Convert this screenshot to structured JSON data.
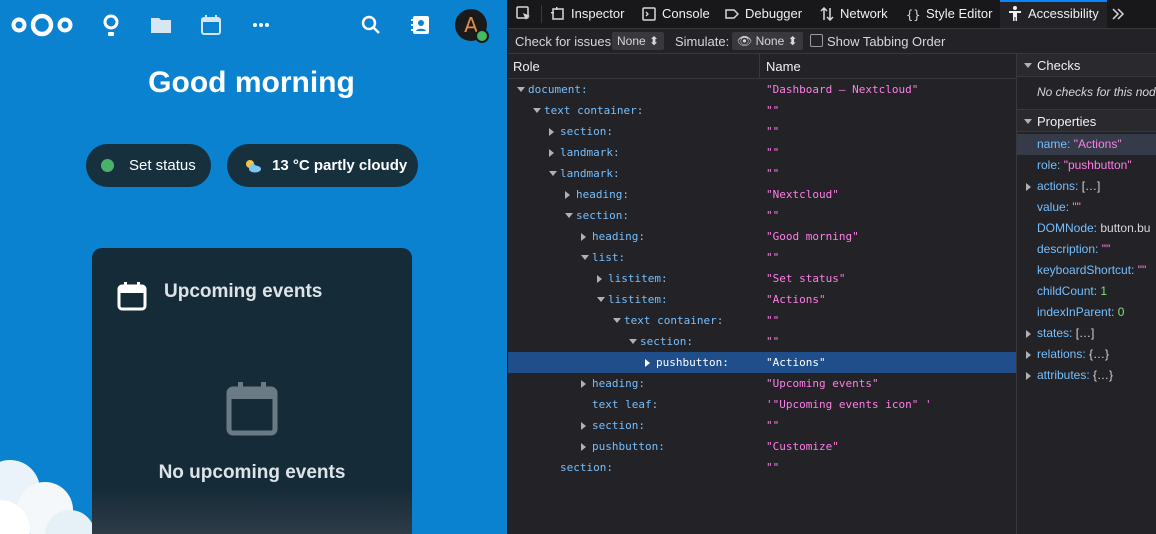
{
  "nextcloud": {
    "greeting": "Good morning",
    "set_status_label": "Set status",
    "weather_label": "13 °C partly cloudy",
    "avatar_letter": "A",
    "card": {
      "title": "Upcoming events",
      "empty_text": "No upcoming events"
    },
    "header_icons": [
      "nextcloud-logo",
      "dashboard-icon",
      "files-icon",
      "calendar-icon",
      "more-apps-icon",
      "search-icon",
      "contacts-icon"
    ],
    "colors": {
      "background": "#0a82d0",
      "pill": "#16303d",
      "status_online": "#49b36b"
    }
  },
  "devtools": {
    "tabs": [
      {
        "label": "Inspector",
        "icon": "inspector-icon"
      },
      {
        "label": "Console",
        "icon": "console-icon"
      },
      {
        "label": "Debugger",
        "icon": "debugger-icon"
      },
      {
        "label": "Network",
        "icon": "network-icon"
      },
      {
        "label": "Style Editor",
        "icon": "style-editor-icon"
      },
      {
        "label": "Accessibility",
        "icon": "accessibility-icon",
        "active": true
      }
    ],
    "toolbar": {
      "check_label": "Check for issues:",
      "check_value": "None",
      "simulate_label": "Simulate:",
      "simulate_value": "None",
      "tabbing_label": "Show Tabbing Order"
    },
    "columns": {
      "role": "Role",
      "name": "Name"
    },
    "rows": [
      {
        "role": "document:",
        "name": "\"Dashboard – Nextcloud\"",
        "depth": 0,
        "twisty": "open"
      },
      {
        "role": "text container:",
        "name": "\"\"",
        "depth": 1,
        "twisty": "open"
      },
      {
        "role": "section:",
        "name": "\"\"",
        "depth": 2,
        "twisty": "closed"
      },
      {
        "role": "landmark:",
        "name": "\"\"",
        "depth": 2,
        "twisty": "closed"
      },
      {
        "role": "landmark:",
        "name": "\"\"",
        "depth": 2,
        "twisty": "open"
      },
      {
        "role": "heading:",
        "name": "\"Nextcloud\"",
        "depth": 3,
        "twisty": "closed"
      },
      {
        "role": "section:",
        "name": "\"\"",
        "depth": 3,
        "twisty": "open"
      },
      {
        "role": "heading:",
        "name": "\"Good morning\"",
        "depth": 4,
        "twisty": "closed"
      },
      {
        "role": "list:",
        "name": "\"\"",
        "depth": 4,
        "twisty": "open"
      },
      {
        "role": "listitem:",
        "name": "\"Set status\"",
        "depth": 5,
        "twisty": "closed"
      },
      {
        "role": "listitem:",
        "name": "\"Actions\"",
        "depth": 5,
        "twisty": "open"
      },
      {
        "role": "text container:",
        "name": "\"\"",
        "depth": 6,
        "twisty": "open"
      },
      {
        "role": "section:",
        "name": "\"\"",
        "depth": 7,
        "twisty": "open"
      },
      {
        "role": "pushbutton:",
        "name": "\"Actions\"",
        "depth": 8,
        "twisty": "closed",
        "selected": true
      },
      {
        "role": "heading:",
        "name": "\"Upcoming events\"",
        "depth": 4,
        "twisty": "closed"
      },
      {
        "role": "text leaf:",
        "name": "'\"Upcoming events icon\" '",
        "depth": 4,
        "twisty": "none"
      },
      {
        "role": "section:",
        "name": "\"\"",
        "depth": 4,
        "twisty": "closed"
      },
      {
        "role": "pushbutton:",
        "name": "\"Customize\"",
        "depth": 4,
        "twisty": "closed"
      },
      {
        "role": "section:",
        "name": "\"\"",
        "depth": 2,
        "twisty": "none"
      }
    ],
    "sidebar": {
      "checks_header": "Checks",
      "checks_note": "No checks for this node",
      "properties_header": "Properties",
      "properties": [
        {
          "key": "name:",
          "value": "\"Actions\"",
          "kind": "str",
          "highlight": true
        },
        {
          "key": "role:",
          "value": "\"pushbutton\"",
          "kind": "str"
        },
        {
          "key": "actions:",
          "value": "[…]",
          "kind": "plain",
          "expandable": true
        },
        {
          "key": "value:",
          "value": "\"\"",
          "kind": "str"
        },
        {
          "key": "DOMNode:",
          "value": "button.bu",
          "kind": "plain"
        },
        {
          "key": "description:",
          "value": "\"\"",
          "kind": "str"
        },
        {
          "key": "keyboardShortcut:",
          "value": "\"\"",
          "kind": "str"
        },
        {
          "key": "childCount:",
          "value": "1",
          "kind": "num"
        },
        {
          "key": "indexInParent:",
          "value": "0",
          "kind": "num"
        },
        {
          "key": "states:",
          "value": "[…]",
          "kind": "plain",
          "expandable": true
        },
        {
          "key": "relations:",
          "value": "{…}",
          "kind": "plain",
          "expandable": true
        },
        {
          "key": "attributes:",
          "value": "{…}",
          "kind": "plain",
          "expandable": true
        }
      ]
    },
    "colors": {
      "accent": "#0a84ff",
      "selected_row": "#204e8a",
      "role_text": "#75bfff",
      "string_text": "#ff7de9",
      "number_text": "#86de74"
    }
  }
}
